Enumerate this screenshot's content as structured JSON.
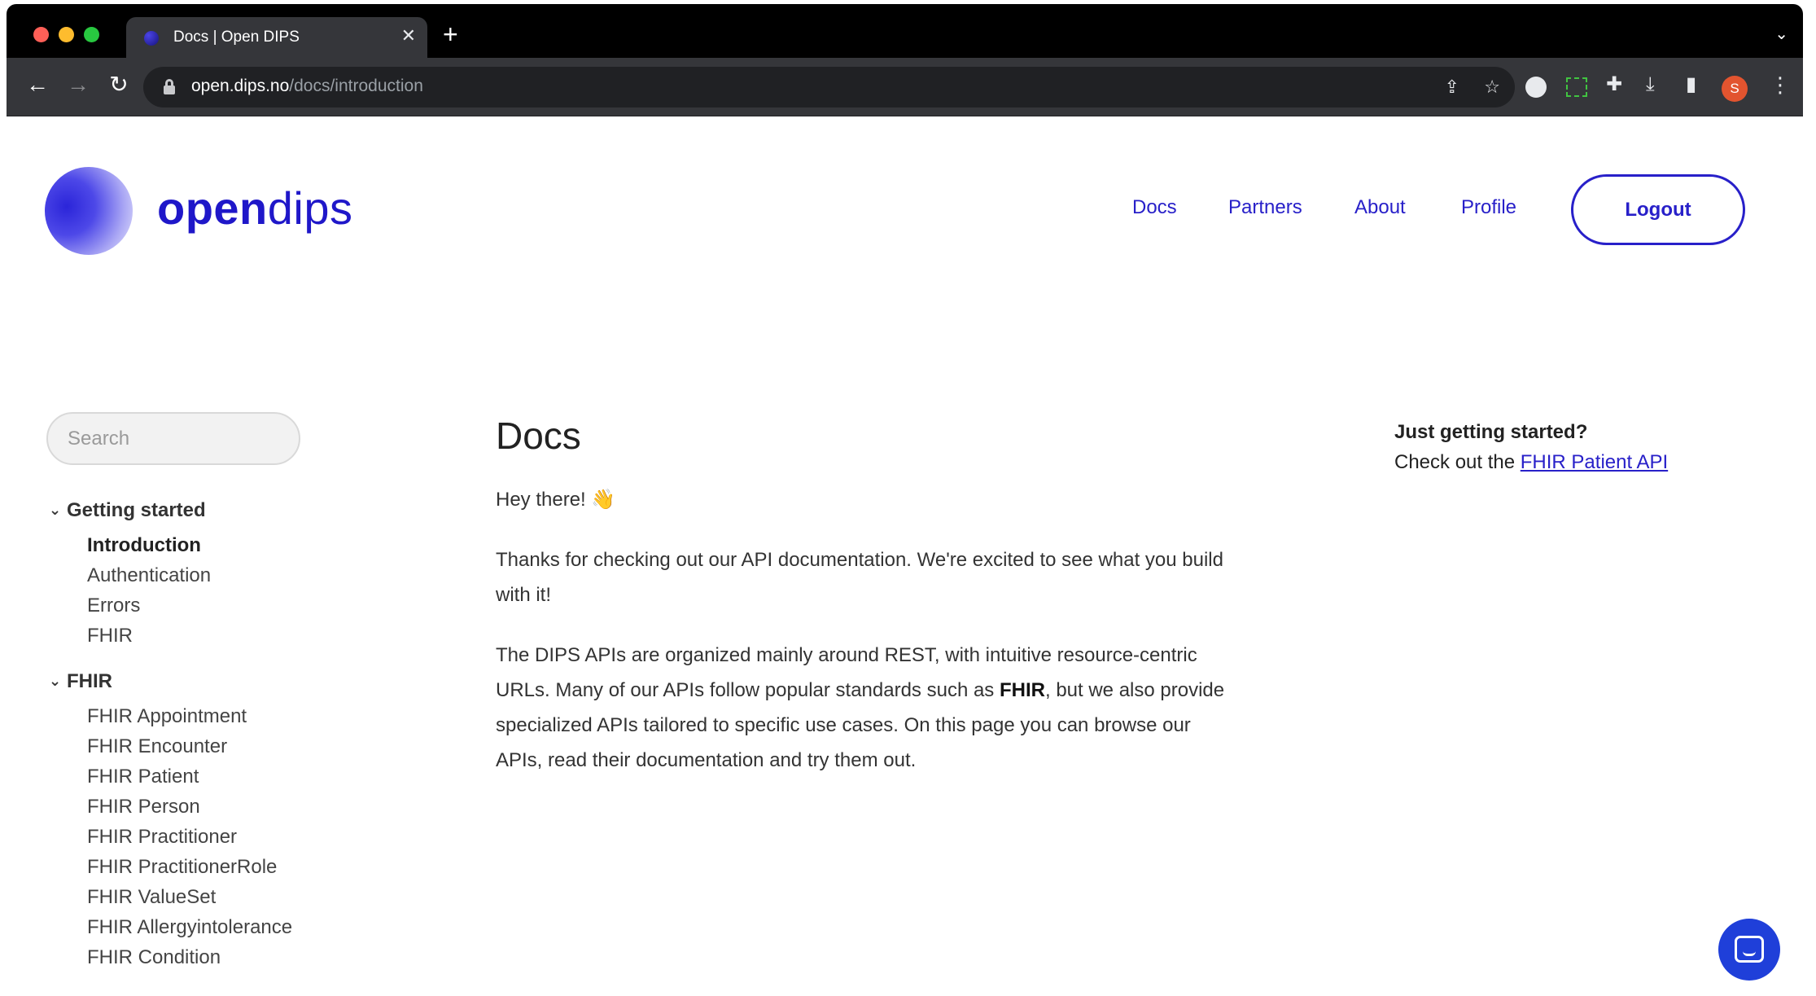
{
  "browser": {
    "tab_title": "Docs | Open DIPS",
    "tab_close": "✕",
    "new_tab": "+",
    "url_host": "open.dips.no",
    "url_path": "/docs/introduction",
    "profile_initial": "S"
  },
  "header": {
    "logo_open": "open",
    "logo_dips": "dips",
    "nav": {
      "docs": "Docs",
      "partners": "Partners",
      "about": "About",
      "profile": "Profile"
    },
    "logout": "Logout"
  },
  "sidebar": {
    "search_placeholder": "Search",
    "sections": [
      {
        "title": "Getting started",
        "items": [
          "Introduction",
          "Authentication",
          "Errors",
          "FHIR"
        ]
      },
      {
        "title": "FHIR",
        "items": [
          "FHIR Appointment",
          "FHIR Encounter",
          "FHIR Patient",
          "FHIR Person",
          "FHIR Practitioner",
          "FHIR PractitionerRole",
          "FHIR ValueSet",
          "FHIR Allergyintolerance",
          "FHIR Condition"
        ]
      }
    ],
    "active_item": "Introduction"
  },
  "main": {
    "title": "Docs",
    "greeting": "Hey there! 👋",
    "thanks": "Thanks for checking out our API documentation. We're excited to see what you build with it!",
    "dips_before": "The DIPS APIs are organized mainly around REST, with intuitive resource-centric URLs. Many of our APIs follow popular standards such as ",
    "dips_bold": "FHIR",
    "dips_after": ", but we also provide specialized APIs tailored to specific use cases. On this page you can browse our APIs, read their documentation and try them out."
  },
  "aside": {
    "heading": "Just getting started?",
    "text_prefix": "Check out the ",
    "link": "FHIR Patient API"
  },
  "colors": {
    "brand": "#2820c9",
    "chat_launcher": "#1f3fd9",
    "text": "#333333"
  }
}
